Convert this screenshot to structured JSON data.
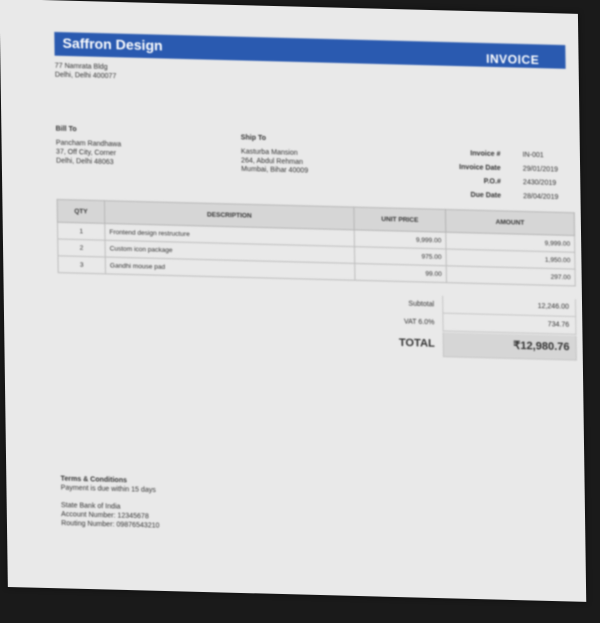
{
  "header": {
    "company": "Saffron Design",
    "title": "INVOICE"
  },
  "company_address": [
    "77 Namrata Bldg",
    "Delhi, Delhi 400077"
  ],
  "bill_to": {
    "heading": "Bill To",
    "lines": [
      "Pancham Randhawa",
      "37, Off City, Corner",
      "Delhi, Delhi 48063"
    ]
  },
  "ship_to": {
    "heading": "Ship To",
    "lines": [
      "Kasturba Mansion",
      "264, Abdul Rehman",
      "Mumbai, Bihar 40009"
    ]
  },
  "meta": [
    {
      "label": "Invoice #",
      "value": "IN-001"
    },
    {
      "label": "Invoice Date",
      "value": "29/01/2019"
    },
    {
      "label": "P.O.#",
      "value": "2430/2019"
    },
    {
      "label": "Due Date",
      "value": "28/04/2019"
    }
  ],
  "table": {
    "headers": [
      "QTY",
      "DESCRIPTION",
      "UNIT PRICE",
      "AMOUNT"
    ],
    "rows": [
      {
        "qty": "1",
        "desc": "Frontend design restructure",
        "price": "9,999.00",
        "amount": "9,999.00"
      },
      {
        "qty": "2",
        "desc": "Custom icon package",
        "price": "975.00",
        "amount": "1,950.00"
      },
      {
        "qty": "3",
        "desc": "Gandhi mouse pad",
        "price": "99.00",
        "amount": "297.00"
      }
    ]
  },
  "totals": {
    "subtotal_label": "Subtotal",
    "subtotal": "12,246.00",
    "tax_label": "VAT 6.0%",
    "tax": "734.76",
    "total_label": "TOTAL",
    "total": "₹12,980.76"
  },
  "footer": {
    "terms_heading": "Terms & Conditions",
    "terms_text": "Payment is due within 15 days",
    "bank_lines": [
      "State Bank of India",
      "Account Number: 12345678",
      "Routing Number: 09876543210"
    ]
  }
}
